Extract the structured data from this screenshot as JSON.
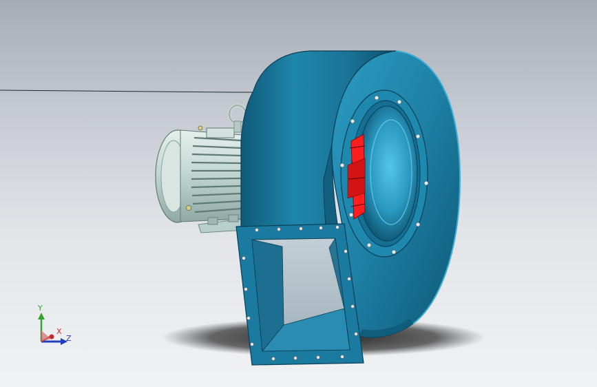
{
  "viewport": {
    "background_top": "#a6acb6",
    "background_bottom": "#f1f2f4"
  },
  "model": {
    "housing_color": "#1d7fa3",
    "impeller_color": "#e02020",
    "motor_color": "#c4d8d3",
    "flange_bolt_color": "#dfe7ea"
  },
  "triad": {
    "x_label": "X",
    "y_label": "Y",
    "z_label": "Z",
    "x_color": "#c42a2a",
    "y_color": "#2fa52f",
    "z_color": "#1f3fbf"
  }
}
